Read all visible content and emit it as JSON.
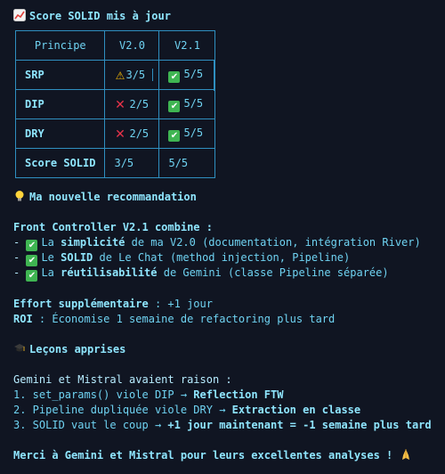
{
  "title": {
    "icon": "chart-increasing-icon",
    "text": "Score SOLID mis à jour"
  },
  "table": {
    "headers": [
      "Principe",
      "V2.0",
      "V2.1"
    ],
    "rows": [
      {
        "principle": "SRP",
        "v20": "3/5",
        "v20_icon": "warning-icon",
        "v21": "5/5",
        "v21_icon": "check-icon"
      },
      {
        "principle": "DIP",
        "v20": "2/5",
        "v20_icon": "cross-icon",
        "v21": "5/5",
        "v21_icon": "check-icon"
      },
      {
        "principle": "DRY",
        "v20": "2/5",
        "v20_icon": "cross-icon",
        "v21": "5/5",
        "v21_icon": "check-icon"
      },
      {
        "principle": "Score SOLID",
        "v20": "3/5",
        "v21": "5/5"
      }
    ]
  },
  "recommendation": {
    "icon": "light-bulb-icon",
    "heading": "Ma nouvelle recommandation"
  },
  "combine": {
    "intro": "Front Controller V2.1 combine :",
    "items": [
      {
        "prefix": "La ",
        "bold": "simplicité",
        "rest": " de ma V2.0 (documentation, intégration River)"
      },
      {
        "prefix": "Le ",
        "bold": "SOLID",
        "rest": " de Le Chat (method injection, Pipeline)"
      },
      {
        "prefix": "La ",
        "bold": "réutilisabilité",
        "rest": " de Gemini (classe Pipeline séparée)"
      }
    ]
  },
  "effort": {
    "label": "Effort supplémentaire",
    "value": " : +1 jour"
  },
  "roi": {
    "label": "ROI",
    "value": " : Économise 1 semaine de refactoring plus tard"
  },
  "lessons": {
    "icon": "graduation-cap-icon",
    "heading": "Leçons apprises"
  },
  "lessons_body": {
    "intro": "Gemini et Mistral avaient raison :",
    "items": [
      {
        "num": "1.",
        "text": " set_params() viole DIP → ",
        "bold": "Reflection FTW"
      },
      {
        "num": "2.",
        "text": " Pipeline dupliquée viole DRY → ",
        "bold": "Extraction en classe"
      },
      {
        "num": "3.",
        "text": " SOLID vaut le coup → ",
        "bold": "+1 jour maintenant = -1 semaine plus tard"
      }
    ]
  },
  "thanks": {
    "text": "Merci à Gemini et Mistral pour leurs excellentes analyses !",
    "icon": "folded-hands-icon"
  },
  "colors": {
    "background": "#101522",
    "text": "#6fd3f2",
    "border": "#2f8fc0",
    "check": "#3fb552",
    "cross": "#e8334a",
    "warning": "#f2b705"
  }
}
